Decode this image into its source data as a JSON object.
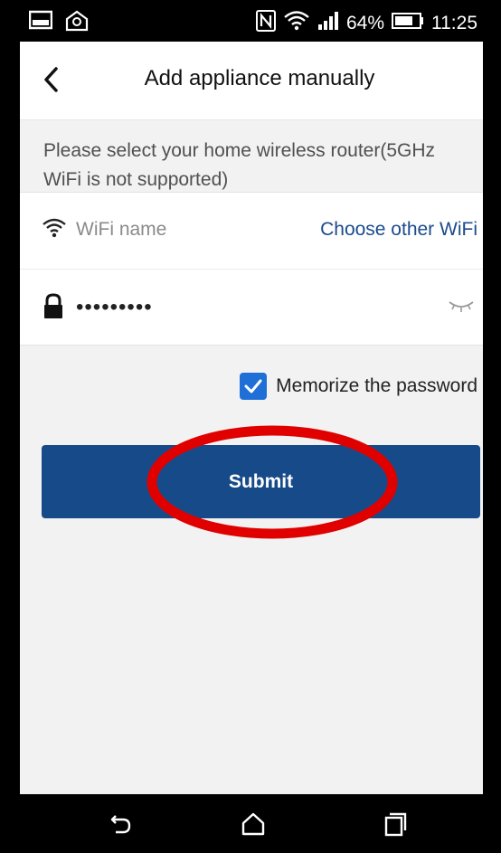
{
  "status_bar": {
    "battery": "64%",
    "time": "11:25",
    "icons": [
      "gallery-icon",
      "email-icon",
      "nfc-icon",
      "wifi-icon",
      "signal-icon",
      "battery-icon"
    ]
  },
  "header": {
    "title": "Add appliance manually",
    "back_icon": "chevron-left-icon"
  },
  "hint": {
    "text": "Please select your home wireless router(5GHz WiFi is not supported)"
  },
  "form": {
    "wifi_placeholder": "WiFi name",
    "choose_other": "Choose other WiFi",
    "password_value": "•••••••••",
    "wifi_icon": "wifi-icon",
    "lock_icon": "lock-icon",
    "eye_icon": "eye-closed-icon"
  },
  "memorize": {
    "label": "Memorize the password",
    "checked": true
  },
  "submit": {
    "label": "Submit"
  },
  "colors": {
    "accent": "#174a89",
    "link": "#1c4b8c",
    "checkbox": "#1f6fd6",
    "highlight": "#e00000",
    "background": "#f2f2f2"
  },
  "nav_bar": {
    "icons": [
      "back-icon",
      "home-icon",
      "recent-apps-icon"
    ]
  }
}
